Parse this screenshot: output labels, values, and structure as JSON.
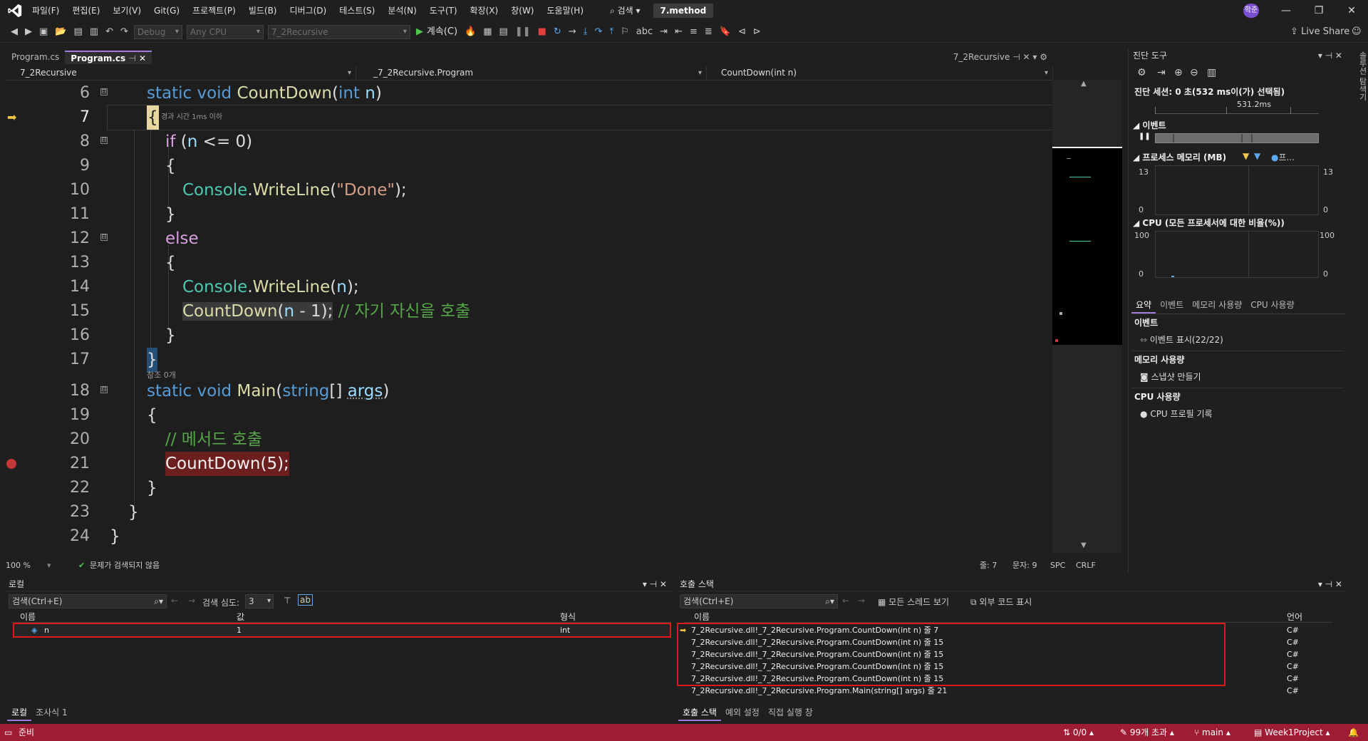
{
  "menubar": {
    "items": [
      "파일(F)",
      "편집(E)",
      "보기(V)",
      "Git(G)",
      "프로젝트(P)",
      "빌드(B)",
      "디버그(D)",
      "테스트(S)",
      "분석(N)",
      "도구(T)",
      "확장(X)",
      "창(W)",
      "도움말(H)"
    ],
    "search": "검색",
    "solution_title": "7.method",
    "avatar": "학준"
  },
  "toolbar": {
    "config": "Debug",
    "platform": "Any CPU",
    "startup_project": "7_2Recursive",
    "continue_label": "계속(C)",
    "live_share": "Live Share"
  },
  "editor_tabs": [
    {
      "label": "Program.cs",
      "active": false
    },
    {
      "label": "Program.cs",
      "active": true
    }
  ],
  "right_tab": "7_2Recursive",
  "navbar": {
    "project": "7_2Recursive",
    "class": "_7_2Recursive.Program",
    "member": "CountDown(int n)"
  },
  "code": {
    "elapsed_hint": "경과 시간 1ms 이하",
    "refs_hint": "참조 0개",
    "line_numbers": [
      "6",
      "7",
      "8",
      "9",
      "10",
      "11",
      "12",
      "13",
      "14",
      "15",
      "16",
      "17",
      "18",
      "19",
      "20",
      "21",
      "22",
      "23",
      "24"
    ]
  },
  "editor_status": {
    "zoom": "100 %",
    "issues": "문제가 검색되지 않음",
    "line": "줄: 7",
    "col": "문자: 9",
    "spc": "SPC",
    "crlf": "CRLF"
  },
  "diagnostics": {
    "title": "진단 도구",
    "session": "진단 세션: 0 초(532 ms이(가) 선택됨)",
    "timeline_mark": "531.2ms",
    "events_label": "이벤트",
    "memory_label": "프로세스 메모리 (MB)",
    "memory_legend": "프...",
    "memory_max": "13",
    "memory_min": "0",
    "cpu_label": "CPU (모든 프로세서에 대한 비율(%))",
    "cpu_max": "100",
    "cpu_min": "0",
    "tabs": [
      "요약",
      "이벤트",
      "메모리 사용량",
      "CPU 사용량"
    ],
    "section_events": "이벤트",
    "show_events": "이벤트 표시(22/22)",
    "section_memory": "메모리 사용량",
    "snapshot": "스냅샷 만들기",
    "section_cpu": "CPU 사용량",
    "cpu_record": "CPU 프로필 기록"
  },
  "side_strip": "솔루션 탐색기",
  "locals": {
    "title": "로컬",
    "search": "검색(Ctrl+E)",
    "depth_label": "검색 심도:",
    "depth_value": "3",
    "headers": [
      "이름",
      "값",
      "형식"
    ],
    "rows": [
      {
        "name": "n",
        "value": "1",
        "type": "int"
      }
    ],
    "bottom_tabs": [
      "로컬",
      "조사식 1"
    ]
  },
  "callstack": {
    "title": "호출 스택",
    "search": "검색(Ctrl+E)",
    "show_threads": "모든 스레드 보기",
    "show_external": "외부 코드 표시",
    "headers": [
      "이름",
      "언어"
    ],
    "rows": [
      {
        "name": "7_2Recursive.dll!_7_2Recursive.Program.CountDown(int n) 줄 7",
        "lang": "C#"
      },
      {
        "name": "7_2Recursive.dll!_7_2Recursive.Program.CountDown(int n) 줄 15",
        "lang": "C#"
      },
      {
        "name": "7_2Recursive.dll!_7_2Recursive.Program.CountDown(int n) 줄 15",
        "lang": "C#"
      },
      {
        "name": "7_2Recursive.dll!_7_2Recursive.Program.CountDown(int n) 줄 15",
        "lang": "C#"
      },
      {
        "name": "7_2Recursive.dll!_7_2Recursive.Program.CountDown(int n) 줄 15",
        "lang": "C#"
      },
      {
        "name": "7_2Recursive.dll!_7_2Recursive.Program.Main(string[] args) 줄 21",
        "lang": "C#"
      }
    ],
    "bottom_tabs": [
      "호출 스택",
      "예외 설정",
      "직접 실행 창"
    ]
  },
  "statusbar": {
    "ready": "준비",
    "changes": "0/0",
    "commits": "99개 초과",
    "branch": "main",
    "repo": "Week1Project"
  },
  "colors": {
    "statusbar": "#9e1d35",
    "highlight_box": "#e01818",
    "accent": "#a27bd8"
  }
}
